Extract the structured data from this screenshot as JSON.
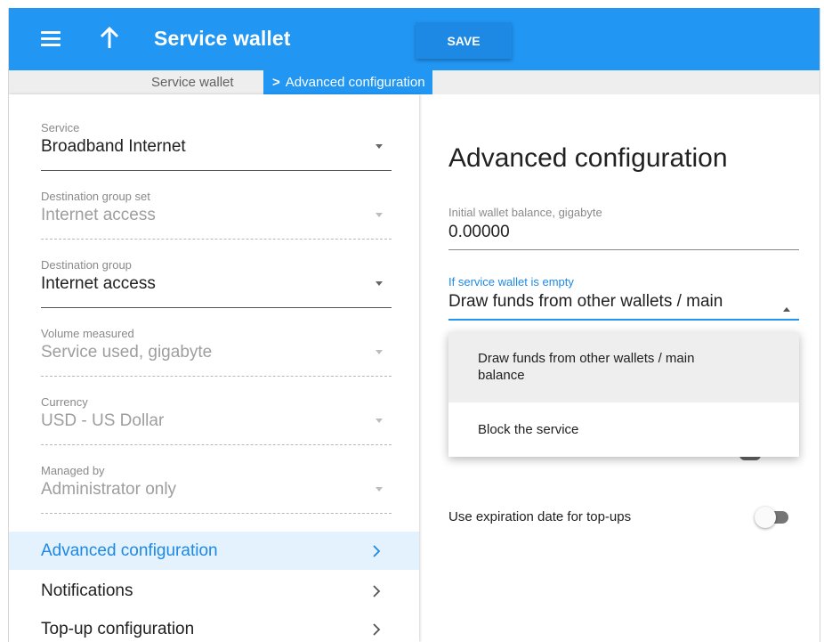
{
  "appbar": {
    "title": "Service wallet",
    "save_label": "SAVE",
    "color": "#2196f3"
  },
  "breadcrumb": {
    "parent": "Service wallet",
    "current": "Advanced configuration"
  },
  "left": {
    "fields": [
      {
        "label": "Service",
        "value": "Broadband Internet",
        "disabled": false
      },
      {
        "label": "Destination group set",
        "value": "Internet access",
        "disabled": true
      },
      {
        "label": "Destination group",
        "value": "Internet access",
        "disabled": false
      },
      {
        "label": "Volume measured",
        "value": "Service used, gigabyte",
        "disabled": true
      },
      {
        "label": "Currency",
        "value": "USD - US Dollar",
        "disabled": true
      },
      {
        "label": "Managed by",
        "value": "Administrator only",
        "disabled": true
      }
    ],
    "nav": [
      {
        "label": "Advanced configuration",
        "active": true
      },
      {
        "label": "Notifications",
        "active": false
      },
      {
        "label": "Top-up configuration",
        "active": false
      }
    ]
  },
  "right": {
    "title": "Advanced configuration",
    "initial_balance": {
      "label": "Initial wallet balance, gigabyte",
      "value": "0.00000"
    },
    "if_empty": {
      "label": "If service wallet is empty",
      "value": "Draw funds from other wallets / main",
      "options": [
        "Draw funds from other wallets / main balance",
        "Block the service"
      ]
    },
    "expiration_toggle": {
      "label": "Use expiration date for top-ups",
      "on": false
    }
  }
}
